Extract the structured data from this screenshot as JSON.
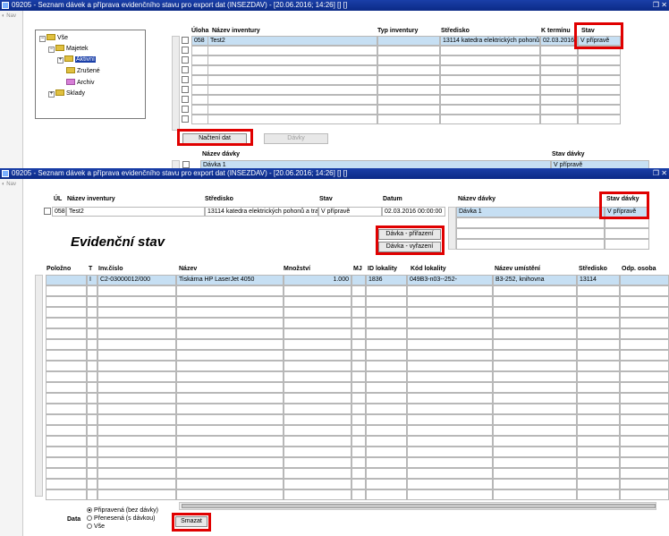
{
  "window1": {
    "title": "09205 - Seznam dávek a příprava evidenčního stavu pro export dat (INSEZDAV) - [20.06.2016; 14:26] [] []",
    "window_controls": "❐ ✕",
    "nav_label": "Nav",
    "tree": [
      {
        "label": "Vše",
        "selected": false,
        "toggle": "−",
        "icon": "folder-icon"
      },
      {
        "label": "Majetek",
        "selected": false,
        "toggle": "−",
        "icon": "folder-icon"
      },
      {
        "label": "Aktivní",
        "selected": true,
        "toggle": "+",
        "icon": "folder-icon"
      },
      {
        "label": "Zrušené",
        "selected": false,
        "toggle": "",
        "icon": "folder-icon"
      },
      {
        "label": "Archiv",
        "selected": false,
        "toggle": "",
        "icon": "folder-icon"
      },
      {
        "label": "Sklady",
        "selected": false,
        "toggle": "+",
        "icon": "folder-icon"
      }
    ],
    "inventory_table": {
      "headers": [
        "Úloha",
        "Název inventury",
        "Typ inventury",
        "Středisko",
        "K termínu",
        "Stav"
      ],
      "rows": [
        [
          "058",
          "Test2",
          "",
          "13114 katedra elektrických pohonů",
          "02.03.2016",
          "V přípravě"
        ]
      ],
      "empty_rows": 8
    },
    "buttons": {
      "load": "Načtení dat",
      "batches": "Dávky"
    },
    "batch_table": {
      "headers": [
        "Název dávky",
        "Stav dávky"
      ],
      "rows": [
        [
          "Dávka 1",
          "V přípravě"
        ]
      ]
    }
  },
  "window2": {
    "title": "09205 - Seznam dávek a příprava evidenčního stavu pro export dat (INSEZDAV) - [20.06.2016; 14:26] [] []",
    "window_controls": "❐ ✕",
    "nav_label": "Nav",
    "inventory_header": {
      "headers": [
        "ÚL",
        "Název inventury",
        "Středisko",
        "Stav",
        "Datum"
      ],
      "values": [
        "058",
        "Test2",
        "13114 katedra elektrických pohonů a tra",
        "V přípravě",
        "02.03.2016 00:00:00"
      ]
    },
    "batch_side": {
      "headers": [
        "Název dávky",
        "Stav dávky"
      ],
      "rows": [
        [
          "Dávka 1",
          "V přípravě"
        ]
      ]
    },
    "section_title": "Evidenční stav",
    "buttons": {
      "assign": "Dávka - přiřazení",
      "unassign": "Dávka - vyřazení",
      "delete": "Smazat"
    },
    "stock_table": {
      "headers": [
        "Položno",
        "T",
        "Inv.číslo",
        "Název",
        "Množství",
        "MJ",
        "ID lokality",
        "Kód lokality",
        "Název umístění",
        "Středisko",
        "Odp. osoba"
      ],
      "rows": [
        [
          "",
          "I",
          "C2-03000012/000",
          "Tiskárna HP LaserJet 4050",
          "1.000",
          "",
          "1836",
          "049B3-n03--252-",
          "B3-252, knihovna",
          "13114",
          ""
        ]
      ],
      "empty_rows": 20
    },
    "data_filter": {
      "label": "Data",
      "options": [
        {
          "label": "Připravená (bez dávky)",
          "checked": true
        },
        {
          "label": "Přenesená (s dávkou)",
          "checked": false
        },
        {
          "label": "Vše",
          "checked": false
        }
      ]
    }
  },
  "colors": {
    "highlight_box": "#e00000",
    "titlebar": "#0b2a86",
    "selected_row": "#c6dff3"
  }
}
